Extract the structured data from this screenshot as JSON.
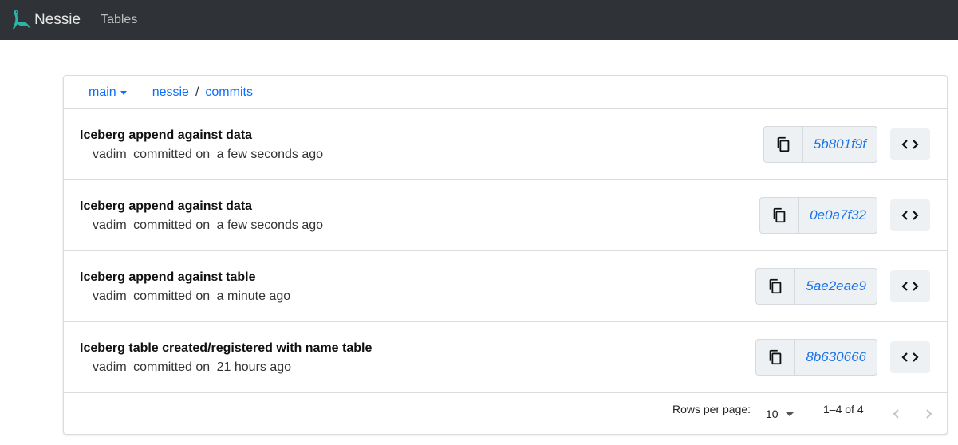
{
  "navbar": {
    "brand": "Nessie",
    "links": [
      "Tables"
    ]
  },
  "header": {
    "branch": "main",
    "breadcrumb": [
      "nessie",
      "commits"
    ],
    "separator": "/"
  },
  "commits": [
    {
      "title": "Iceberg append against data",
      "author": "vadim",
      "action": "committed on",
      "time": "a few seconds ago",
      "hash": "5b801f9f"
    },
    {
      "title": "Iceberg append against data",
      "author": "vadim",
      "action": "committed on",
      "time": "a few seconds ago",
      "hash": "0e0a7f32"
    },
    {
      "title": "Iceberg append against table",
      "author": "vadim",
      "action": "committed on",
      "time": "a minute ago",
      "hash": "5ae2eae9"
    },
    {
      "title": "Iceberg table created/registered with name table",
      "author": "vadim",
      "action": "committed on",
      "time": "21 hours ago",
      "hash": "8b630666"
    }
  ],
  "pagination": {
    "rows_per_page_label": "Rows per page:",
    "rows_per_page": "10",
    "range": "1–4 of 4"
  },
  "colors": {
    "navbar": "#2f3236",
    "link": "#0d6efd",
    "hash": "#1a73e8",
    "logo": "#2bb5a8"
  },
  "icons": {
    "copy": "copy-icon",
    "code": "code-icon",
    "prev": "chevron-left-icon",
    "next": "chevron-right-icon"
  }
}
